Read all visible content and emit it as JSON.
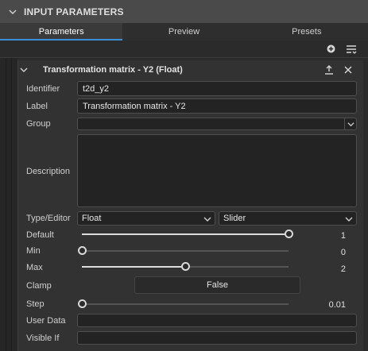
{
  "panel": {
    "title": "INPUT PARAMETERS"
  },
  "tabs": [
    {
      "label": "Parameters",
      "active": true
    },
    {
      "label": "Preview",
      "active": false
    },
    {
      "label": "Presets",
      "active": false
    }
  ],
  "toolbar": {
    "icons": [
      "add-circle-icon",
      "sort-list-icon"
    ]
  },
  "section": {
    "title": "Transformation matrix - Y2 (Float)",
    "icons": [
      "export-icon",
      "close-icon"
    ]
  },
  "form": {
    "identifier": {
      "label": "Identifier",
      "value": "t2d_y2"
    },
    "label": {
      "label": "Label",
      "value": "Transformation matrix - Y2"
    },
    "group": {
      "label": "Group",
      "value": ""
    },
    "description": {
      "label": "Description",
      "value": ""
    },
    "type_editor": {
      "label": "Type/Editor",
      "type": "Float",
      "editor": "Slider"
    },
    "default": {
      "label": "Default",
      "value": "1",
      "fraction": 1.0
    },
    "min": {
      "label": "Min",
      "value": "0",
      "fraction": 0.0
    },
    "max": {
      "label": "Max",
      "value": "2",
      "fraction": 0.5
    },
    "clamp": {
      "label": "Clamp",
      "value": "False"
    },
    "step": {
      "label": "Step",
      "value": "0.01",
      "fraction": 0.0
    },
    "user_data": {
      "label": "User Data",
      "value": ""
    },
    "visible_if": {
      "label": "Visible If",
      "value": ""
    }
  },
  "colors": {
    "accent": "#3b8fd6",
    "header_bg": "#4a4a4a",
    "panel_bg": "#323232"
  }
}
